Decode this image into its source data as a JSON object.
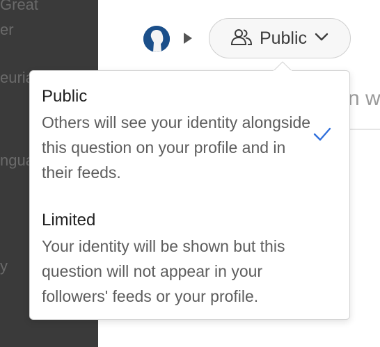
{
  "sidebar": {
    "fragments": [
      "Great",
      "er",
      "euria",
      "ngua",
      "y"
    ]
  },
  "header": {
    "audience_button": {
      "label": "Public",
      "icon": "people-icon",
      "chevron": "chevron-down-icon"
    }
  },
  "background": {
    "input_fragment": "n w"
  },
  "popover": {
    "options": [
      {
        "title": "Public",
        "description": "Others will see your identity alongside this question on your profile and in their feeds.",
        "selected": true
      },
      {
        "title": "Limited",
        "description": "Your identity will be shown but this question will not appear in your followers' feeds or your profile.",
        "selected": false
      }
    ]
  },
  "colors": {
    "accent": "#2f6fdc",
    "sidebar": "#3a3a3a",
    "text_primary": "#1f1f1f",
    "text_secondary": "#5d5d5d"
  }
}
